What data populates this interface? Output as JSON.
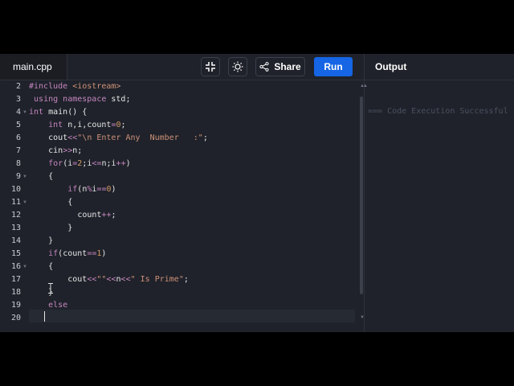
{
  "tab": {
    "filename": "main.cpp"
  },
  "toolbar": {
    "share_label": "Share",
    "run_label": "Run",
    "icons": [
      "collapse-icon",
      "brightness-icon",
      "share-icon"
    ]
  },
  "output": {
    "title": "Output",
    "message": "=== Code Execution Successful"
  },
  "editor": {
    "line_numbers": [
      "2",
      "3",
      "4",
      "5",
      "6",
      "7",
      "8",
      "9",
      "10",
      "11",
      "12",
      "13",
      "14",
      "15",
      "16",
      "17",
      "18",
      "19",
      "20"
    ],
    "lines": [
      "#include <iostream>",
      " using namespace std;",
      "int main() {",
      "    int n,i,count=0;",
      "    cout<<\"\\n Enter Any  Number   :\";",
      "    cin>>n;",
      "    for(i=2;i<=n;i++)",
      "    {",
      "        if(n%i==0)",
      "        {",
      "          count++;",
      "        }",
      "    }",
      "    if(count==1)",
      "    {",
      "        cout<<\"\"<<n<<\" Is Prime\";",
      "    }",
      "    else",
      ""
    ]
  },
  "colors": {
    "accent": "#1565e4",
    "background": "#1f222a"
  }
}
